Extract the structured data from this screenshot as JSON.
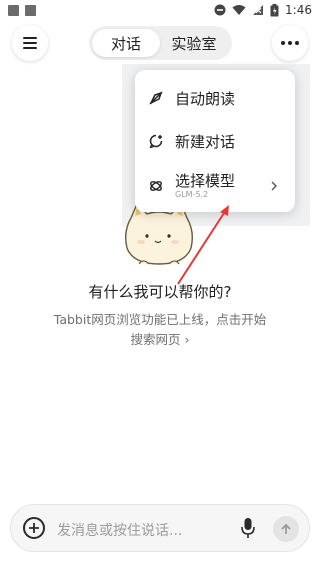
{
  "status_bar": {
    "time": "1:46"
  },
  "header": {
    "tabs": [
      {
        "label": "对话"
      },
      {
        "label": "实验室"
      }
    ],
    "menu_icon": "hamburger-icon",
    "more_icon": "more-dots-icon"
  },
  "menu": {
    "items": [
      {
        "label": "自动朗读",
        "icon": "auto-read-icon"
      },
      {
        "label": "新建对话",
        "icon": "new-chat-icon"
      },
      {
        "label": "选择模型",
        "sublabel": "GLM-5.2",
        "icon": "model-icon"
      }
    ]
  },
  "main": {
    "headline": "有什么我可以帮你的?",
    "tip": "Tabbit网页浏览功能已上线，点击开始搜索网页 ›"
  },
  "input": {
    "placeholder": "发消息或按住说话..."
  },
  "colors": {
    "arrow": "#e53935"
  }
}
